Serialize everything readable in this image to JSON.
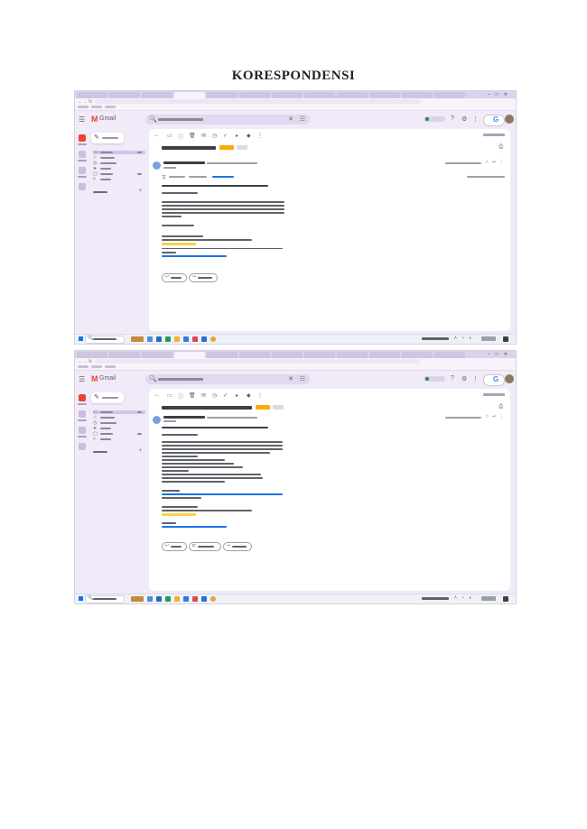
{
  "document": {
    "title": "KORESPONDENSI"
  },
  "gmail": {
    "logo_letter": "M",
    "logo_text": "Gmail"
  },
  "icons": {
    "hamburger": "☰",
    "search": "🔍",
    "clear": "✕",
    "tune": "☷",
    "compose": "✎",
    "reply": "↩",
    "forward": "↪",
    "print": "⎙",
    "star": "☆",
    "back": "←",
    "forward_nav": "→",
    "reload": "↻",
    "windows_start": "⊞"
  },
  "colors": {
    "gmail_red": "#ea4335",
    "highlight": "#f6d34a",
    "link": "#1a73e8",
    "badge": "#f9ab00"
  }
}
